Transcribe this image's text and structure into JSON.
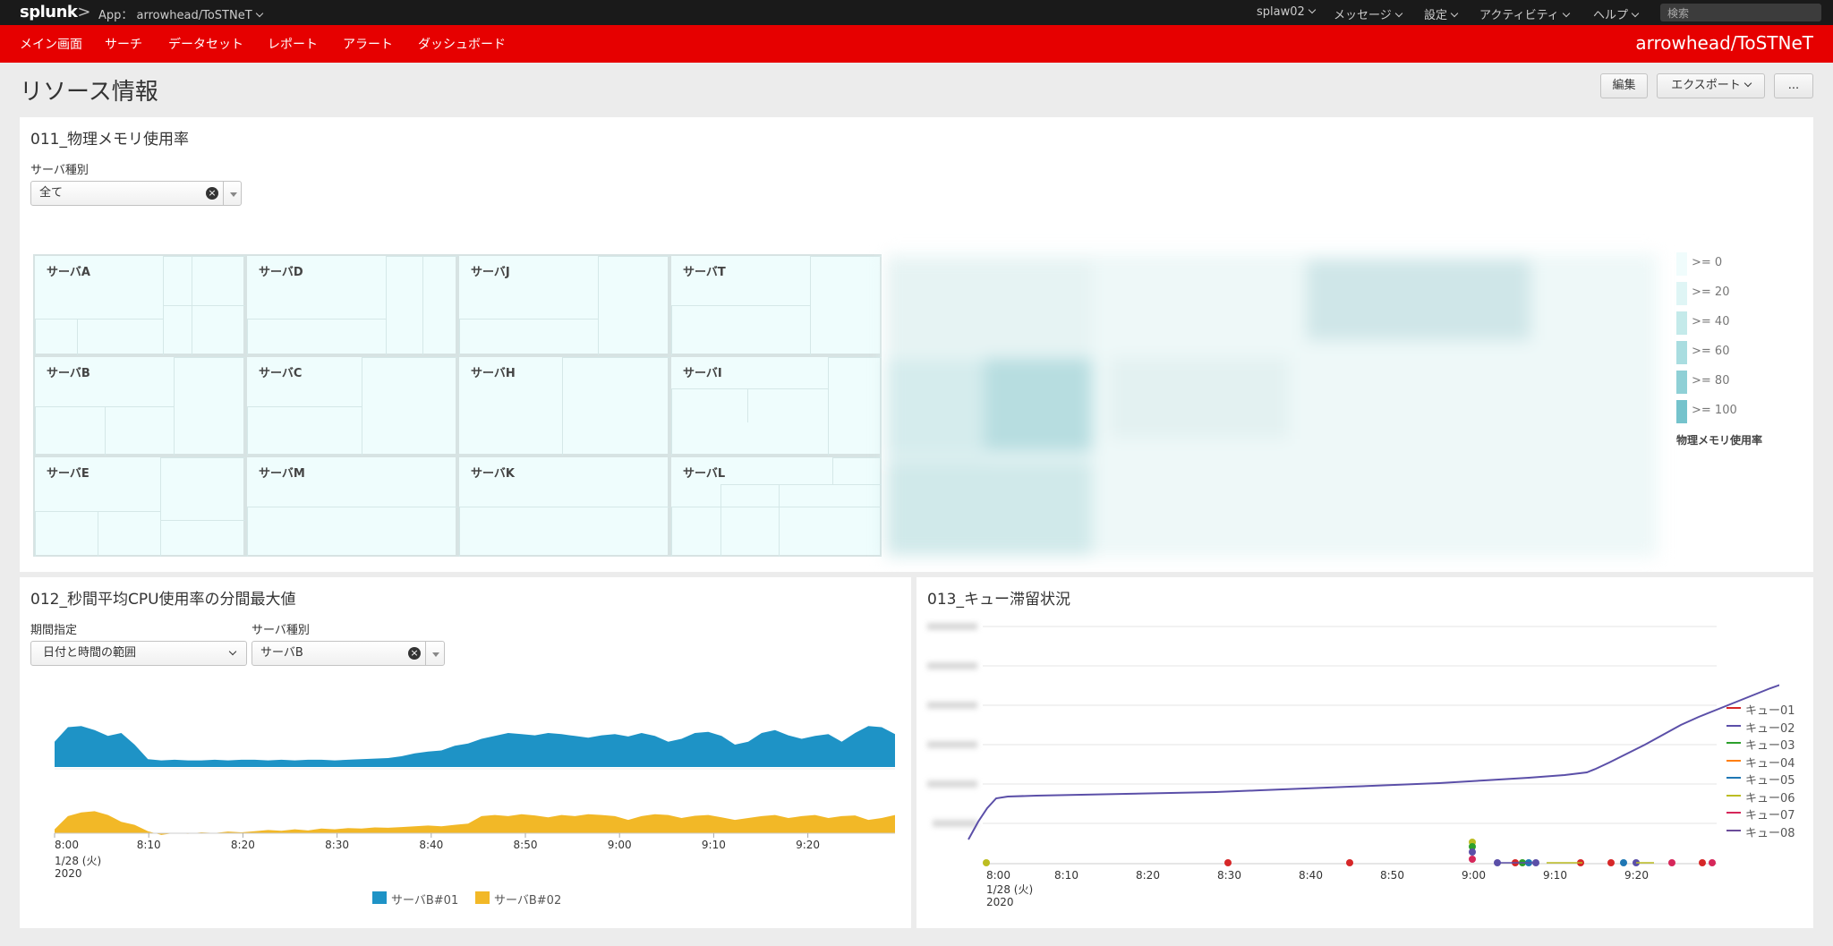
{
  "sysbar": {
    "logo": "splunk",
    "logo_suffix": ">",
    "app": "App： arrowhead/ToSTNeT",
    "menus": [
      "splaw02",
      "メッセージ",
      "設定",
      "アクティビティ",
      "ヘルプ"
    ],
    "search_placeholder": "検索"
  },
  "nav": {
    "items": [
      "メイン画面",
      "サーチ",
      "データセット",
      "レポート",
      "アラート",
      "ダッシュボード"
    ],
    "app_title": "arrowhead/ToSTNeT"
  },
  "page": {
    "title": "リソース情報",
    "edit": "編集",
    "export": "エクスポート",
    "more": "..."
  },
  "panel1": {
    "title": "011_物理メモリ使用率",
    "filter_label": "サーバ種別",
    "filter_value": "全て",
    "servers": [
      "サーバA",
      "サーバD",
      "サーバJ",
      "サーバT",
      "サーバB",
      "サーバC",
      "サーバH",
      "サーバI",
      "サーバE",
      "サーバM",
      "サーバK",
      "サーバL"
    ],
    "legend": {
      "items": [
        ">= 0",
        ">= 20",
        ">= 40",
        ">= 60",
        ">= 80",
        ">= 100"
      ],
      "colors": [
        "#f0fcfc",
        "#dff5f5",
        "#c4eaea",
        "#a9dde0",
        "#8fd0d6",
        "#75c3cc"
      ],
      "title": "物理メモリ使用率"
    }
  },
  "panel2": {
    "title": "012_秒間平均CPU使用率の分間最大値",
    "period_label": "期間指定",
    "period_value": "日付と時間の範囲",
    "server_label": "サーバ種別",
    "server_value": "サーバB",
    "x_ticks": [
      "8:00",
      "8:10",
      "8:20",
      "8:30",
      "8:40",
      "8:50",
      "9:00",
      "9:10",
      "9:20"
    ],
    "x_date": "1/28 (火)",
    "x_year": "2020",
    "legend": [
      "サーバB#01",
      "サーバB#02"
    ],
    "colors": [
      "#1e93c6",
      "#f2b827"
    ]
  },
  "panel3": {
    "title": "013_キュー滞留状況",
    "x_ticks": [
      "8:00",
      "8:10",
      "8:20",
      "8:30",
      "8:40",
      "8:50",
      "9:00",
      "9:10",
      "9:20"
    ],
    "x_date": "1/28 (火)",
    "x_year": "2020",
    "legend": [
      "キュー01",
      "キュー02",
      "キュー03",
      "キュー04",
      "キュー05",
      "キュー06",
      "キュー07",
      "キュー08"
    ],
    "colors": [
      "#d62728",
      "#5b4fa8",
      "#2ca02c",
      "#ff7f0e",
      "#1f77b4",
      "#bcbd22",
      "#d6275a",
      "#6b4c9a"
    ]
  }
}
